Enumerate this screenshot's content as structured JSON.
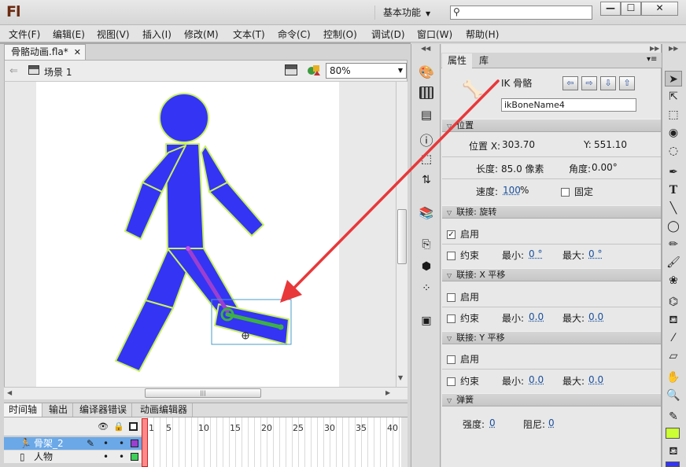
{
  "app": {
    "logo": "Fl",
    "workspace": "基本功能",
    "search_placeholder": ""
  },
  "window_buttons": [
    "—",
    "☐",
    "✕"
  ],
  "menu": [
    "文件(F)",
    "编辑(E)",
    "视图(V)",
    "插入(I)",
    "修改(M)",
    "文本(T)",
    "命令(C)",
    "控制(O)",
    "调试(D)",
    "窗口(W)",
    "帮助(H)"
  ],
  "document": {
    "tab": "骨骼动画.fla*",
    "tab_close": "✕",
    "scene": "场景 1",
    "zoom": "80%"
  },
  "timeline": {
    "tabs": [
      "时间轴",
      "输出",
      "编译器错误",
      "动画编辑器"
    ],
    "frame_ticks": [
      "1",
      "5",
      "10",
      "15",
      "20",
      "25",
      "30",
      "35",
      "40"
    ],
    "layers": [
      {
        "name": "骨架_2",
        "selected": true,
        "color": "#9b3fd0"
      },
      {
        "name": "人物",
        "selected": false,
        "color": "#3fd05a"
      }
    ]
  },
  "properties": {
    "tabs": [
      "属性",
      "库"
    ],
    "type": "IK 骨骼",
    "bone_name": "ikBoneName4",
    "nav_buttons": [
      "⇦",
      "⇨",
      "⇩",
      "⇧"
    ],
    "position": {
      "header": "位置",
      "x_label": "位置 X:",
      "x": "303.70",
      "y_label": "Y:",
      "y": "551.10",
      "length_label": "长度:",
      "length": "85.0 像素",
      "angle_label": "角度:",
      "angle": "0.00°",
      "speed_label": "速度:",
      "speed": "100",
      "speed_unit": "%",
      "fixed_label": "固定"
    },
    "joint_rotation": {
      "header": "联接: 旋转",
      "enable": "启用",
      "enabled": true,
      "constrain": "约束",
      "min_label": "最小:",
      "min": "0 °",
      "max_label": "最大:",
      "max": "0 °"
    },
    "joint_x": {
      "header": "联接: X 平移",
      "enable": "启用",
      "constrain": "约束",
      "min_label": "最小:",
      "min": "0.0",
      "max_label": "最大:",
      "max": "0.0"
    },
    "joint_y": {
      "header": "联接: Y 平移",
      "enable": "启用",
      "constrain": "约束",
      "min_label": "最小:",
      "min": "0.0",
      "max_label": "最大:",
      "max": "0.0"
    },
    "spring": {
      "header": "弹簧",
      "strength_label": "强度:",
      "strength": "0",
      "damping_label": "阻尼:",
      "damping": "0"
    }
  },
  "colors": {
    "figure_fill": "#3434f4",
    "figure_stroke": "#c8f060",
    "bone": "#3cb043",
    "arrow": "#e8383a",
    "fill_swatch": "#ccff33",
    "stroke_swatch": "#111111"
  }
}
